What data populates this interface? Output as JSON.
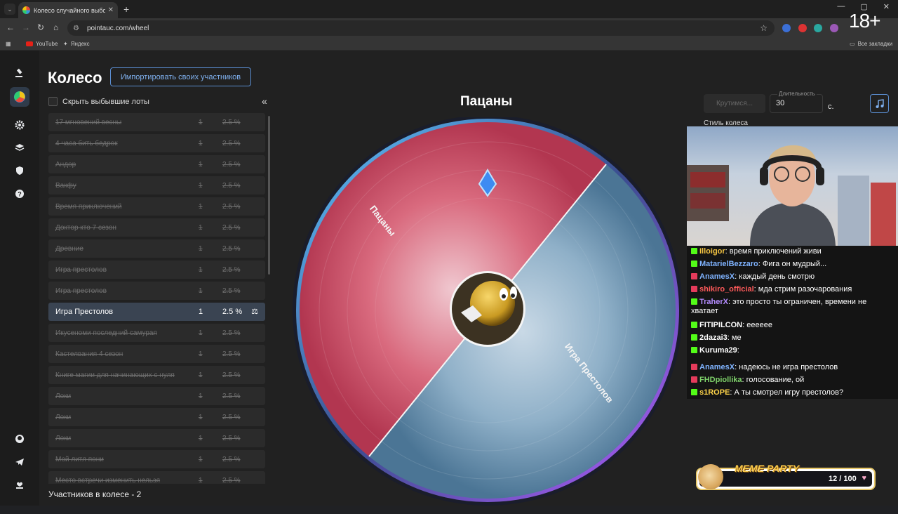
{
  "browser": {
    "tab_title": "Колесо случайного выбора - ",
    "url": "pointauc.com/wheel",
    "bookmarks": [
      "YouTube",
      "Яндекс"
    ],
    "all_bookmarks": "Все закладки",
    "age_badge": "18+"
  },
  "app": {
    "title": "Колесо",
    "import_button": "Импортировать своих участников",
    "hide_eliminated": "Скрыть выбывшие лоты",
    "participants_count": "Участников в колесе - 2",
    "lots": [
      {
        "name": "17 мгновений весны",
        "amount": "1",
        "pct": "2.5 %",
        "eliminated": true
      },
      {
        "name": "4 часа бить бедрок",
        "amount": "1",
        "pct": "2.5 %",
        "eliminated": true
      },
      {
        "name": "Андор",
        "amount": "1",
        "pct": "2.5 %",
        "eliminated": true
      },
      {
        "name": "Вакфу",
        "amount": "1",
        "pct": "2.5 %",
        "eliminated": true
      },
      {
        "name": "Время приключений",
        "amount": "1",
        "pct": "2.5 %",
        "eliminated": true
      },
      {
        "name": "Доктор кто 7 сезон",
        "amount": "1",
        "pct": "2.5 %",
        "eliminated": true
      },
      {
        "name": "Древние",
        "amount": "1",
        "pct": "2.5 %",
        "eliminated": true
      },
      {
        "name": "Игра престолов",
        "amount": "1",
        "pct": "2.5 %",
        "eliminated": true
      },
      {
        "name": "Игра престолов",
        "amount": "1",
        "pct": "2.5 %",
        "eliminated": true
      },
      {
        "name": "Игра Престолов",
        "amount": "1",
        "pct": "2.5 %",
        "eliminated": false
      },
      {
        "name": "Икусеноми последний самурая",
        "amount": "1",
        "pct": "2.5 %",
        "eliminated": true
      },
      {
        "name": "Кастелвания 4 сезон",
        "amount": "1",
        "pct": "2.5 %",
        "eliminated": true
      },
      {
        "name": "Книге магии для начинающих с нуля",
        "amount": "1",
        "pct": "2.5 %",
        "eliminated": true
      },
      {
        "name": "Локи",
        "amount": "1",
        "pct": "2.5 %",
        "eliminated": true
      },
      {
        "name": "Локи",
        "amount": "1",
        "pct": "2.5 %",
        "eliminated": true
      },
      {
        "name": "Локи",
        "amount": "1",
        "pct": "2.5 %",
        "eliminated": true
      },
      {
        "name": "Мой литл пони",
        "amount": "1",
        "pct": "2.5 %",
        "eliminated": true
      },
      {
        "name": "Место встречи изменить нельзя",
        "amount": "1",
        "pct": "2.5 %",
        "eliminated": true
      }
    ]
  },
  "wheel": {
    "winner": "Пацаны",
    "segments": [
      {
        "label": "Пацаны",
        "color": "#c9485f"
      },
      {
        "label": "Игра Престолов",
        "color": "#4f7f9f"
      }
    ]
  },
  "controls": {
    "spin_button": "Крутимся...",
    "duration_label": "Длительность",
    "duration_value": "30",
    "duration_unit": "с.",
    "wheel_style": "Стиль колеса"
  },
  "chat": [
    {
      "badge": "k",
      "user": "Illoigor",
      "color": "#f5c542",
      "text": "время приключений живи"
    },
    {
      "badge": "k",
      "user": "MatarielBezzaro",
      "color": "#7fb3ff",
      "text": "Фига он мудрый..."
    },
    {
      "badge": "live",
      "user": "AnamesX",
      "color": "#7fb3ff",
      "text": "каждый день смотрю"
    },
    {
      "badge": "live",
      "user": "shikiro_official",
      "color": "#ff5a5a",
      "text": "мда стрим разочарования"
    },
    {
      "badge": "k",
      "user": "TraherX",
      "color": "#b48cff",
      "text": "это просто ты ограничен, времени не хватает"
    },
    {
      "badge": "k",
      "user": "FITIPILCON",
      "color": "#ffffff",
      "text": "eeeeee"
    },
    {
      "badge": "k",
      "user": "2dazai3",
      "color": "#ffffff",
      "text": "ме"
    },
    {
      "badge": "k",
      "user": "Kuruma29",
      "color": "#ffffff",
      "text": ""
    },
    {
      "badge": "live",
      "user": "AnamesX",
      "color": "#7fb3ff",
      "text": "надеюсь не игра престолов"
    },
    {
      "badge": "live",
      "user": "FHDpiollika",
      "color": "#7fd36b",
      "text": "голосование, ой"
    },
    {
      "badge": "k",
      "user": "s1ROPE",
      "color": "#ffd54a",
      "text": "А ты смотрел игру престолов?"
    }
  ],
  "meme_party": {
    "title": "MEME PARTY",
    "progress": "12 / 100"
  }
}
